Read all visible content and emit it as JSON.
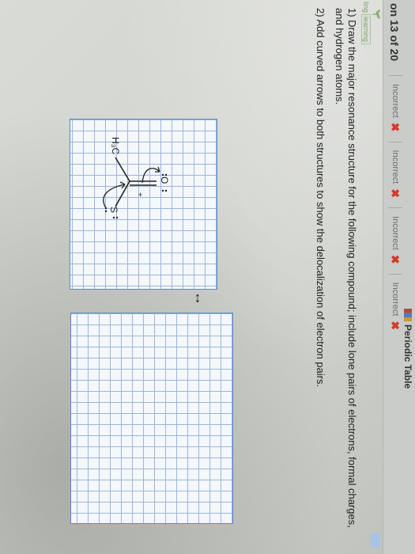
{
  "header": {
    "question_counter": "on 13 of 20",
    "periodic_table_label": "Periodic Table",
    "attempts": [
      {
        "label": "Incorrect"
      },
      {
        "label": "Incorrect"
      },
      {
        "label": "Incorrect"
      },
      {
        "label": "Incorrect"
      }
    ]
  },
  "brand": {
    "text": "ling",
    "tag": "learning"
  },
  "instructions": {
    "step1": "1) Draw the major resonance structure for the following compound; include lone pairs of electrons, formal charges, and hydrogen atoms.",
    "step2": "2) Add curved arrows to both structures to show the delocalization of electron pairs."
  },
  "molecule": {
    "methyl_label": "H₃C",
    "oxygen_label": "O",
    "sulfur_label": "S",
    "charge_label": "+"
  },
  "resonance_arrow": "↔",
  "colors": {
    "incorrect_x": "#d23a2a",
    "grid_line": "#9ab6df",
    "grid_border": "#5c89c7"
  }
}
